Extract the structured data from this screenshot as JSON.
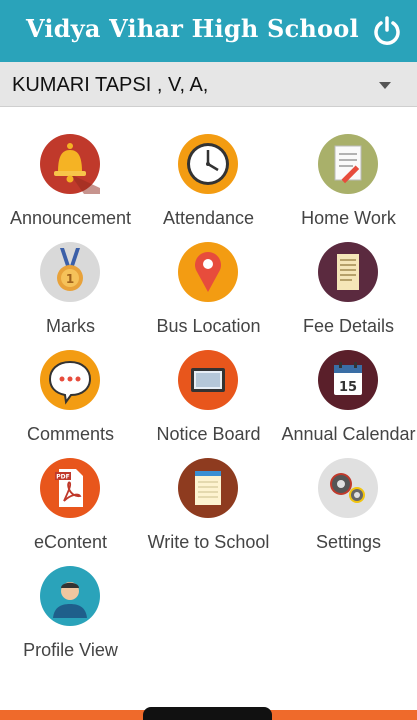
{
  "header": {
    "title": "Vidya Vihar High School",
    "power_icon": "power-icon"
  },
  "student_selector": {
    "value": "KUMARI TAPSI , V, A,"
  },
  "menu": [
    {
      "label": "Announcement",
      "icon": "bell-icon",
      "color": "#c0392b"
    },
    {
      "label": "Attendance",
      "icon": "clock-icon",
      "color": "#f39c12"
    },
    {
      "label": "Home Work",
      "icon": "notebook-pencil-icon",
      "color": "#a9b06a"
    },
    {
      "label": "Marks",
      "icon": "medal-icon",
      "color": "#d9d9d9"
    },
    {
      "label": "Bus Location",
      "icon": "map-pin-icon",
      "color": "#f39c12"
    },
    {
      "label": "Fee Details",
      "icon": "receipt-icon",
      "color": "#5b2a3f"
    },
    {
      "label": "Comments",
      "icon": "speech-bubble-icon",
      "color": "#f39c12"
    },
    {
      "label": "Notice Board",
      "icon": "board-icon",
      "color": "#e8561c"
    },
    {
      "label": "Annual Calendar",
      "icon": "calendar-icon",
      "color": "#5a1f2a"
    },
    {
      "label": "eContent",
      "icon": "pdf-icon",
      "color": "#e8561c"
    },
    {
      "label": "Write to School",
      "icon": "note-icon",
      "color": "#8e3b1f"
    },
    {
      "label": "Settings",
      "icon": "gears-icon",
      "color": "#e0e0e0"
    },
    {
      "label": "Profile View",
      "icon": "profile-icon",
      "color": "#2aa3ba"
    }
  ],
  "calendar_day": "15",
  "pdf_tag": "PDF"
}
